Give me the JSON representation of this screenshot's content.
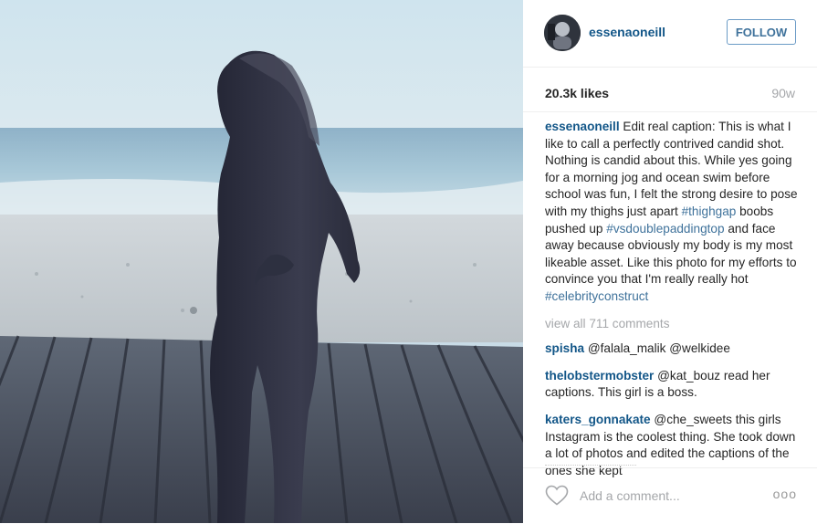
{
  "post": {
    "username": "essenaoneill",
    "follow_label": "FOLLOW",
    "likes": "20.3k likes",
    "age": "90w",
    "caption_before_tag1": "Edit real caption: This is what I like to call a perfectly contrived candid shot. Nothing is candid about this. While yes going for a morning jog and ocean swim before school was fun, I felt the strong desire to pose with my thighs just apart ",
    "tag1": "#thighgap",
    "caption_between_tags": " boobs pushed up ",
    "tag2": "#vsdoublepaddingtop",
    "caption_after_tag2": " and face away because obviously my body is my most likeable asset. Like this photo for my efforts to convince you that I'm really really hot ",
    "tag3": "#celebrityconstruct",
    "view_all": "view all 711 comments"
  },
  "comments": [
    {
      "user": "spisha",
      "text": "@falala_malik @welkidee"
    },
    {
      "user": "thelobstermobster",
      "text": "@kat_bouz read her captions. This girl is a boss."
    },
    {
      "user": "katers_gonnakate",
      "text": "@che_sweets this girls Instagram is the coolest thing. She took down a lot of photos and edited the captions of the ones she kept"
    }
  ],
  "footer": {
    "add_comment_placeholder": "Add a comment...",
    "more_label": "ooo"
  },
  "icons": {
    "like": "heart-outline-icon",
    "more": "more-options-icon"
  },
  "colors": {
    "username_blue": "#125688",
    "follow_blue": "#3f729b",
    "muted_gray": "#a5a7aa"
  }
}
